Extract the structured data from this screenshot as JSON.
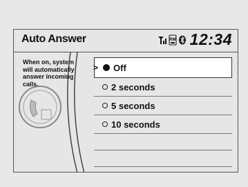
{
  "header": {
    "title": "Auto Answer",
    "clock": "12:34",
    "status_icons": [
      "signal-icon",
      "roaming-icon",
      "bluetooth-icon"
    ],
    "roaming_label": "RM"
  },
  "description": "When on, system will automatically answer incoming calls.",
  "options": [
    {
      "label": "Off",
      "selected": true
    },
    {
      "label": "2 seconds",
      "selected": false
    },
    {
      "label": "5 seconds",
      "selected": false
    },
    {
      "label": "10 seconds",
      "selected": false
    }
  ]
}
